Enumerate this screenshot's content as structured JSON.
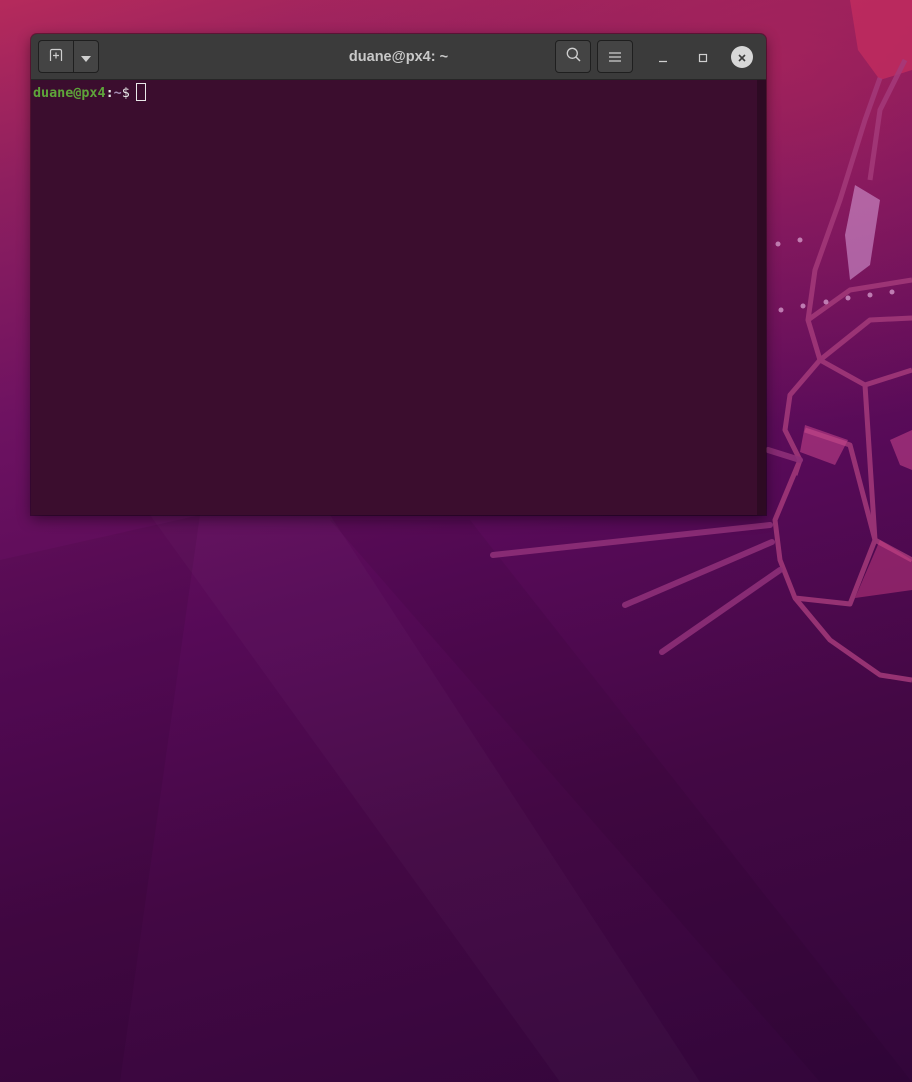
{
  "window": {
    "title": "duane@px4: ~"
  },
  "headerbar": {
    "icons": {
      "new_tab": "new-tab-icon",
      "tab_menu": "chevron-down-icon",
      "search": "search-icon",
      "menu": "hamburger-menu-icon",
      "minimize": "minimize-icon",
      "maximize": "maximize-icon",
      "close": "close-icon"
    }
  },
  "terminal": {
    "prompt_user_host": "duane@px4",
    "prompt_separator": ":",
    "prompt_path": "~",
    "prompt_symbol": "$",
    "input": ""
  },
  "colors": {
    "terminal_background": "#3b0d2e",
    "prompt_user_color": "#5ea43a",
    "headerbar_background": "#3b3b3b"
  }
}
